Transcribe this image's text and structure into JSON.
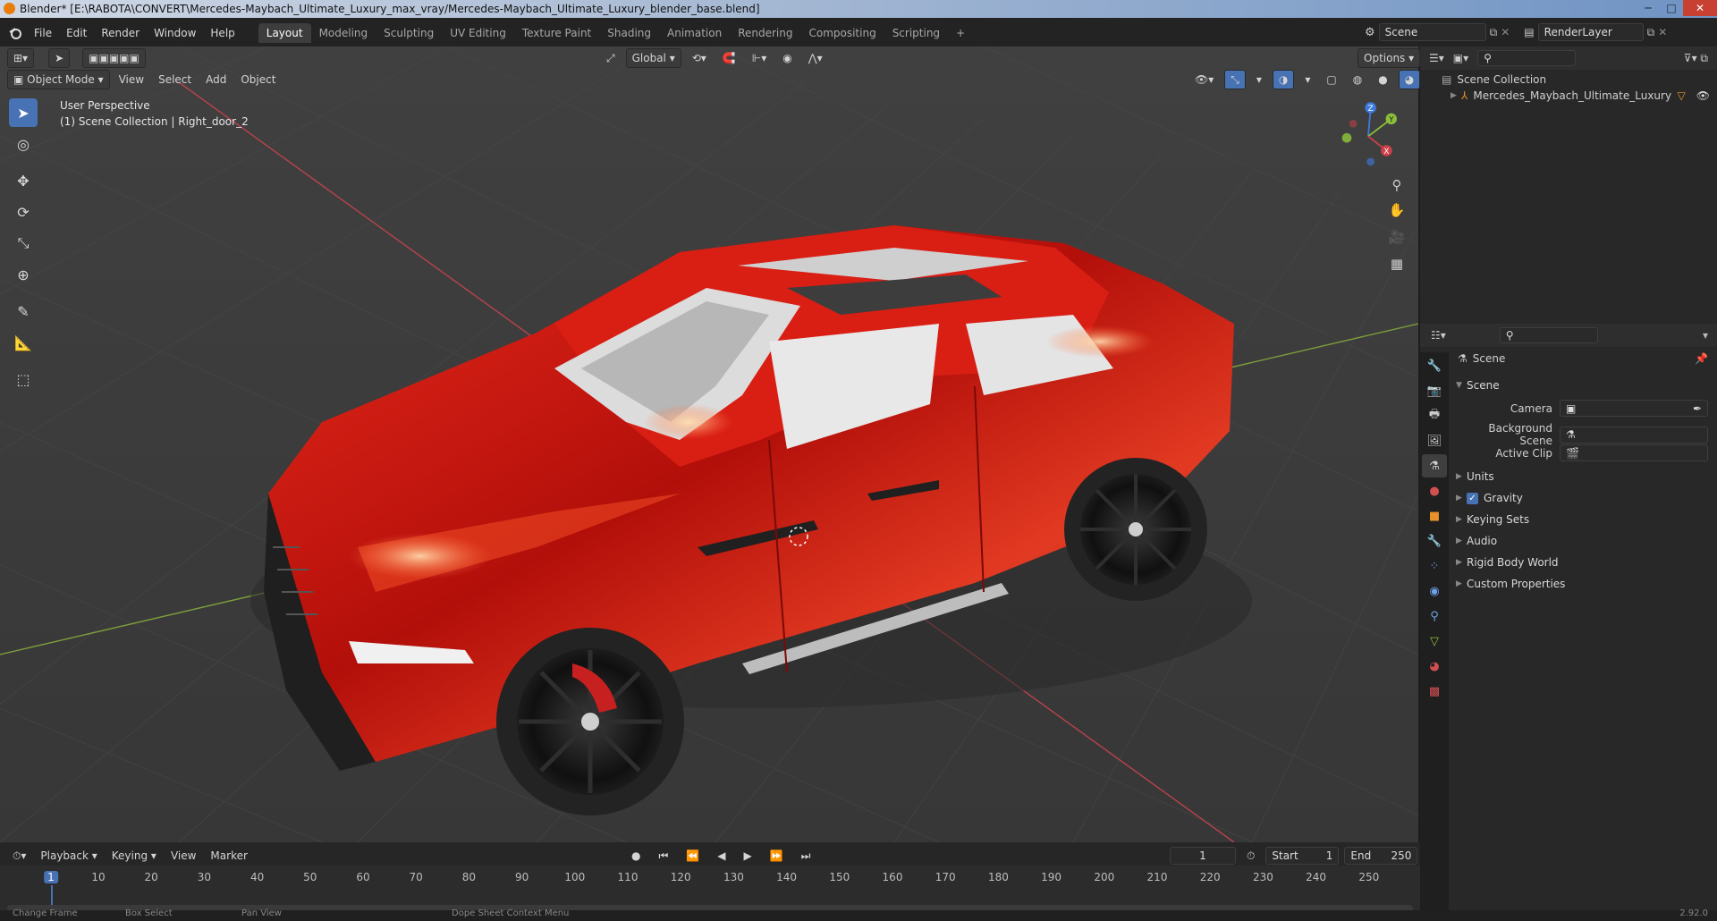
{
  "window": {
    "title": "Blender* [E:\\RABOTA\\CONVERT\\Mercedes-Maybach_Ultimate_Luxury_max_vray/Mercedes-Maybach_Ultimate_Luxury_blender_base.blend]",
    "min": "─",
    "max": "□",
    "close": "✕"
  },
  "menu": [
    "File",
    "Edit",
    "Render",
    "Window",
    "Help"
  ],
  "workspaces": [
    "Layout",
    "Modeling",
    "Sculpting",
    "UV Editing",
    "Texture Paint",
    "Shading",
    "Animation",
    "Rendering",
    "Compositing",
    "Scripting"
  ],
  "add_workspace": "+",
  "scene_field": "Scene",
  "render_layer_field": "RenderLayer",
  "viewport_header": {
    "orientation": "Global",
    "options": "Options",
    "mode": "Object Mode",
    "menus": [
      "View",
      "Select",
      "Add",
      "Object"
    ]
  },
  "viewport_info": {
    "line1": "User Perspective",
    "line2": "(1) Scene Collection | Right_door_2"
  },
  "gizmo": {
    "x": "X",
    "y": "Y",
    "z": "Z"
  },
  "outliner": {
    "root": "Scene Collection",
    "items": [
      "Mercedes_Maybach_Ultimate_Luxury"
    ]
  },
  "properties": {
    "header": "Scene",
    "section": "Scene",
    "fields": [
      {
        "label": "Camera",
        "value": ""
      },
      {
        "label": "Background Scene",
        "value": ""
      },
      {
        "label": "Active Clip",
        "value": ""
      }
    ],
    "subpanels": [
      "Units",
      "Gravity",
      "Keying Sets",
      "Audio",
      "Rigid Body World",
      "Custom Properties"
    ],
    "gravity_checked": true
  },
  "timeline": {
    "menus": [
      "Playback",
      "Keying",
      "View",
      "Marker"
    ],
    "current_frame": "1",
    "start_label": "Start",
    "start": "1",
    "end_label": "End",
    "end": "250",
    "ticks": [
      "1",
      "10",
      "20",
      "30",
      "40",
      "50",
      "60",
      "70",
      "80",
      "90",
      "100",
      "110",
      "120",
      "130",
      "140",
      "150",
      "160",
      "170",
      "180",
      "190",
      "200",
      "210",
      "220",
      "230",
      "240",
      "250"
    ]
  },
  "status_bar": {
    "items": [
      "Change Frame",
      "Box Select",
      "Pan View",
      "Dope Sheet Context Menu"
    ],
    "version": "2.92.0"
  },
  "colors": {
    "accent": "#4772b3",
    "car_red": "#c8150f",
    "axis_x": "#d0404a",
    "axis_y": "#8cbf3a",
    "axis_z": "#3d7be0"
  }
}
